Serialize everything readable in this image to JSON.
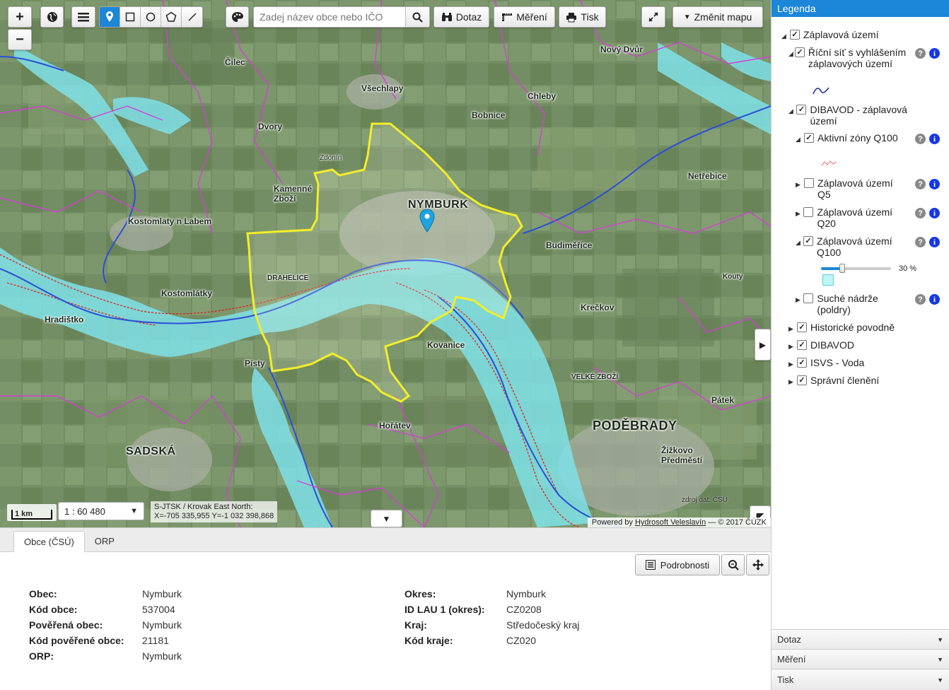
{
  "toolbar": {
    "zoom_in": "+",
    "zoom_out": "−",
    "search_placeholder": "Zadej název obce nebo IČO",
    "query_label": "Dotaz",
    "measure_label": "Měření",
    "print_label": "Tisk",
    "change_map_label": "Změnit mapu"
  },
  "map": {
    "labels": {
      "nymburk": "NYMBURK",
      "podebrady": "PODĚBRADY",
      "sadska": "SADSKÁ",
      "vsechlapy": "Všechlapy",
      "bobnice": "Bobnice",
      "chleby": "Chleby",
      "dvory": "Dvory",
      "kamenne_zhori": "Kamenné Zboží",
      "kostomlaty": "Kostomlaty n Labem",
      "kostomlatky": "Kostomlátky",
      "hradistko": "Hradištko",
      "pisty": "Písty",
      "kovanice": "Kovanice",
      "horatev": "Hořátev",
      "budimerice": "Budiměřice",
      "netrebice": "Netřebice",
      "krecakov": "Krečkov",
      "patek": "Pátek",
      "zizkovo_predmesti": "Žižkovo Předměstí",
      "velke_zbozi": "VELKÉ ZBOŽÍ",
      "drahelice": "DRAHELICE",
      "novy_dvur": "Nový Dvůr",
      "cilec": "Čilec",
      "zdonin": "Zdonín",
      "koully": "Kouty"
    },
    "scale_bar_label": "1 km",
    "scale_value": "1 : 60 480",
    "coords_line1": "S-JTSK / Krovak East North:",
    "coords_line2": "X=-705 335,955 Y=-1 032 398,868",
    "attribution_prefix": "Powered by",
    "attribution_link": "Hydrosoft Veleslavín",
    "attribution_suffix": "— © 2017 ČÚZK",
    "source_note": "zdroj dat: ČSÚ"
  },
  "bottom": {
    "tabs": [
      {
        "label": "Obce (ČSÚ)",
        "active": true
      },
      {
        "label": "ORP",
        "active": false
      }
    ],
    "details_label": "Podrobnosti",
    "left_fields": [
      {
        "key": "Obec",
        "value": "Nymburk"
      },
      {
        "key": "Kód obce",
        "value": "537004"
      },
      {
        "key": "Pověřená obec",
        "value": "Nymburk"
      },
      {
        "key": "Kód pověřené obce",
        "value": "21181"
      },
      {
        "key": "ORP",
        "value": "Nymburk"
      }
    ],
    "right_fields": [
      {
        "key": "Okres",
        "value": "Nymburk"
      },
      {
        "key": "ID LAU 1 (okres)",
        "value": "CZ0208"
      },
      {
        "key": "Kraj",
        "value": "Středočeský kraj"
      },
      {
        "key": "Kód kraje",
        "value": "CZ020"
      }
    ]
  },
  "legend": {
    "title": "Legenda",
    "items": {
      "zaplavova_uzemi": "Záplavová území",
      "ricni_sit": "Říční síť s vyhlášením záplavových území",
      "dibavod_zu": "DIBAVOD - záplavová území",
      "aktivni_zony": "Aktivní zóny Q100",
      "zu_q5": "Záplavová území Q5",
      "zu_q20": "Záplavová území Q20",
      "zu_q100": "Záplavová území Q100",
      "opacity": "30 %",
      "opacity_value": 0.3,
      "suche_nadrze": "Suché nádrže (poldry)",
      "historicke": "Historické povodně",
      "dibavod": "DIBAVOD",
      "isvs": "ISVS - Voda",
      "spravni": "Správní členění"
    },
    "accordions": [
      "Dotaz",
      "Měření",
      "Tisk"
    ]
  },
  "colors": {
    "accent": "#1c86d8",
    "municipality_outline": "#f2ee2a",
    "flood_zone": "#7fe0e8",
    "river": "#2a4fd8",
    "boundaries": "#d43fd6"
  }
}
